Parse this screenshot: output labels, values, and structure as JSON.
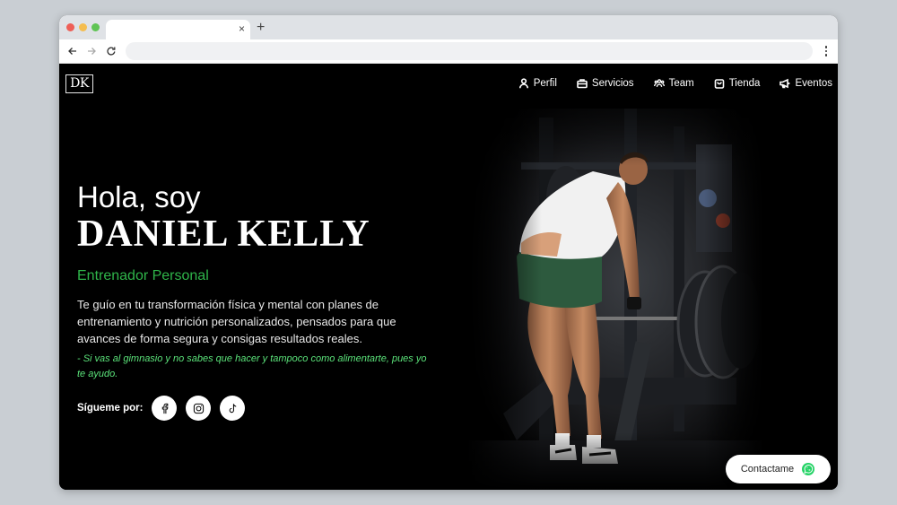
{
  "browser": {
    "tab_close": "×",
    "tab_new": "+"
  },
  "logo": {
    "text": "DK"
  },
  "nav": {
    "items": [
      {
        "label": "Perfil",
        "icon": "user-icon"
      },
      {
        "label": "Servicios",
        "icon": "briefcase-icon"
      },
      {
        "label": "Team",
        "icon": "users-icon"
      },
      {
        "label": "Tienda",
        "icon": "shopping-bag-icon"
      },
      {
        "label": "Eventos",
        "icon": "megaphone-icon"
      }
    ]
  },
  "hero": {
    "greeting": "Hola, soy",
    "name": "DANIEL KELLY",
    "role": "Entrenador Personal",
    "description": "Te guío en tu transformación física y mental con planes de entrenamiento y nutrición personalizados, pensados para que avances de forma segura y consigas resultados reales.",
    "quote": "- Si vas al gimnasio y no sabes que hacer y tampoco como alimentarte, pues yo te ayudo.",
    "social_label": "Sígueme por:",
    "social": [
      {
        "name": "facebook",
        "icon": "facebook-icon"
      },
      {
        "name": "instagram",
        "icon": "instagram-icon"
      },
      {
        "name": "tiktok",
        "icon": "tiktok-icon"
      }
    ]
  },
  "contact": {
    "label": "Contactame",
    "icon": "whatsapp-icon"
  },
  "colors": {
    "accent_green": "#2fb54a",
    "quote_green": "#5be37a",
    "whatsapp": "#25d366",
    "background": "#000000"
  }
}
